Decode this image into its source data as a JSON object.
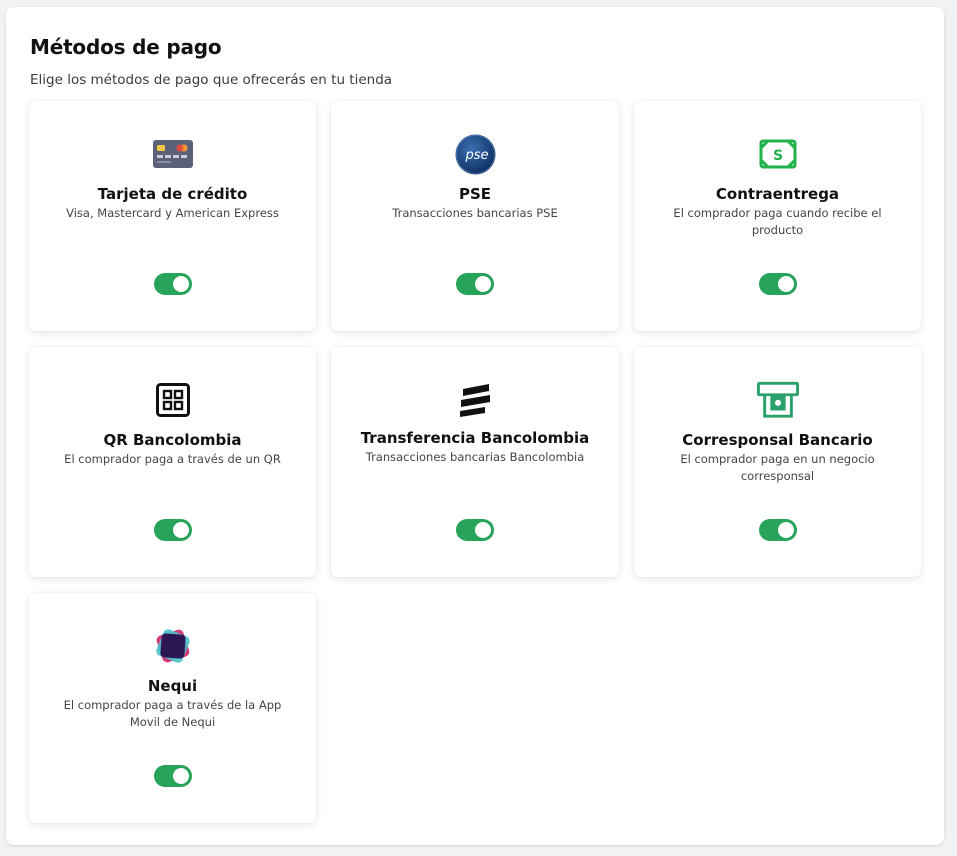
{
  "header": {
    "title": "Métodos de pago",
    "subtitle": "Elige los métodos de pago que ofrecerás en tu tienda"
  },
  "colors": {
    "toggle_on": "#27a35a",
    "green_icon": "#22b14c",
    "teal_icon": "#2aa06a"
  },
  "methods": [
    {
      "icon": "credit-card-icon",
      "title": "Tarjeta de crédito",
      "description": "Visa, Mastercard y American Express",
      "enabled": true
    },
    {
      "icon": "pse-logo-icon",
      "title": "PSE",
      "description": "Transacciones bancarias PSE",
      "enabled": true,
      "logo_text": "pse"
    },
    {
      "icon": "cash-icon",
      "title": "Contraentrega",
      "description": "El comprador paga cuando recibe el producto",
      "enabled": true,
      "logo_text": "S"
    },
    {
      "icon": "qr-icon",
      "title": "QR Bancolombia",
      "description": "El comprador paga a través de un QR",
      "enabled": true
    },
    {
      "icon": "bancolombia-logo-icon",
      "title": "Transferencia Bancolombia",
      "description": "Transacciones bancarias Bancolombia",
      "enabled": true
    },
    {
      "icon": "atm-icon",
      "title": "Corresponsal Bancario",
      "description": "El comprador paga en un negocio corresponsal",
      "enabled": true
    },
    {
      "icon": "nequi-logo-icon",
      "title": "Nequi",
      "description": "El comprador paga a través de la App Movil de Nequi",
      "enabled": true
    }
  ]
}
